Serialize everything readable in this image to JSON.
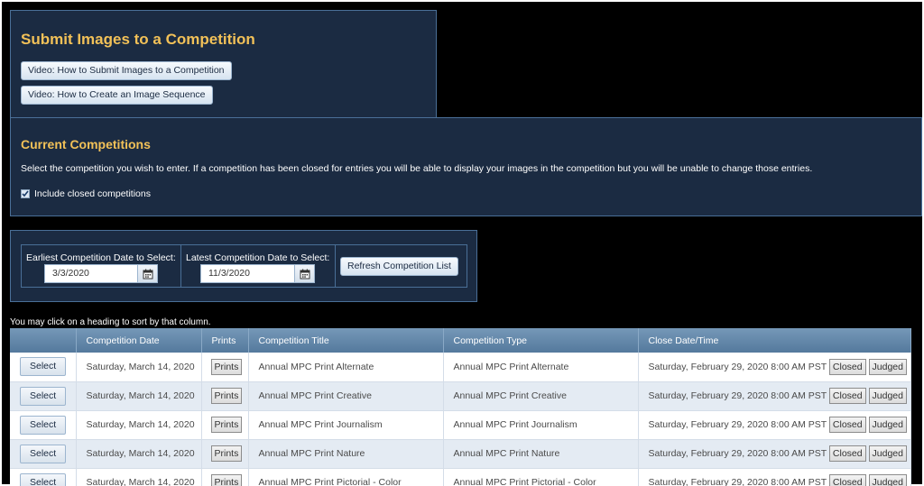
{
  "submit": {
    "title": "Submit Images to a Competition",
    "video1": "Video: How to Submit Images to a Competition",
    "video2": "Video: How to Create an Image Sequence"
  },
  "current": {
    "title": "Current Competitions",
    "description": "Select the competition you wish to enter. If a competition has been closed for entries you will be able to display your images in the competition but you will be unable to change those entries.",
    "include_closed_label": "Include closed competitions",
    "include_closed_checked": true
  },
  "date_filter": {
    "earliest_label": "Earliest Competition Date to Select:",
    "earliest_value": "3/3/2020",
    "latest_label": "Latest Competition Date to Select:",
    "latest_value": "11/3/2020",
    "refresh_label": "Refresh Competition List"
  },
  "sort_hint": "You may click on a heading to sort by that column.",
  "table": {
    "headers": [
      "",
      "Competition Date",
      "Prints",
      "Competition Title",
      "Competition Type",
      "Close Date/Time"
    ],
    "rows": [
      {
        "select": "Select",
        "date": "Saturday, March 14, 2020",
        "prints": "Prints",
        "title": "Annual MPC Print Alternate",
        "type": "Annual MPC Print Alternate",
        "close": "Saturday, February 29, 2020 8:00 AM PST",
        "closed": "Closed",
        "judged": "Judged"
      },
      {
        "select": "Select",
        "date": "Saturday, March 14, 2020",
        "prints": "Prints",
        "title": "Annual MPC Print Creative",
        "type": "Annual MPC Print Creative",
        "close": "Saturday, February 29, 2020 8:00 AM PST",
        "closed": "Closed",
        "judged": "Judged"
      },
      {
        "select": "Select",
        "date": "Saturday, March 14, 2020",
        "prints": "Prints",
        "title": "Annual MPC Print Journalism",
        "type": "Annual MPC Print Journalism",
        "close": "Saturday, February 29, 2020 8:00 AM PST",
        "closed": "Closed",
        "judged": "Judged"
      },
      {
        "select": "Select",
        "date": "Saturday, March 14, 2020",
        "prints": "Prints",
        "title": "Annual MPC Print Nature",
        "type": "Annual MPC Print Nature",
        "close": "Saturday, February 29, 2020 8:00 AM PST",
        "closed": "Closed",
        "judged": "Judged"
      },
      {
        "select": "Select",
        "date": "Saturday, March 14, 2020",
        "prints": "Prints",
        "title": "Annual MPC Print Pictorial - Color",
        "type": "Annual MPC Print Pictorial - Color",
        "close": "Saturday, February 29, 2020 8:00 AM PST",
        "closed": "Closed",
        "judged": "Judged"
      }
    ]
  },
  "colors": {
    "page_bg": "#000000",
    "panel_bg": "#1b2b42",
    "panel_border": "#4a6f97",
    "heading_gold": "#f2c158",
    "table_header": "#5f84a8"
  },
  "icons": {
    "date_picker": "calendar-icon",
    "checkbox": "checkmark-icon"
  }
}
